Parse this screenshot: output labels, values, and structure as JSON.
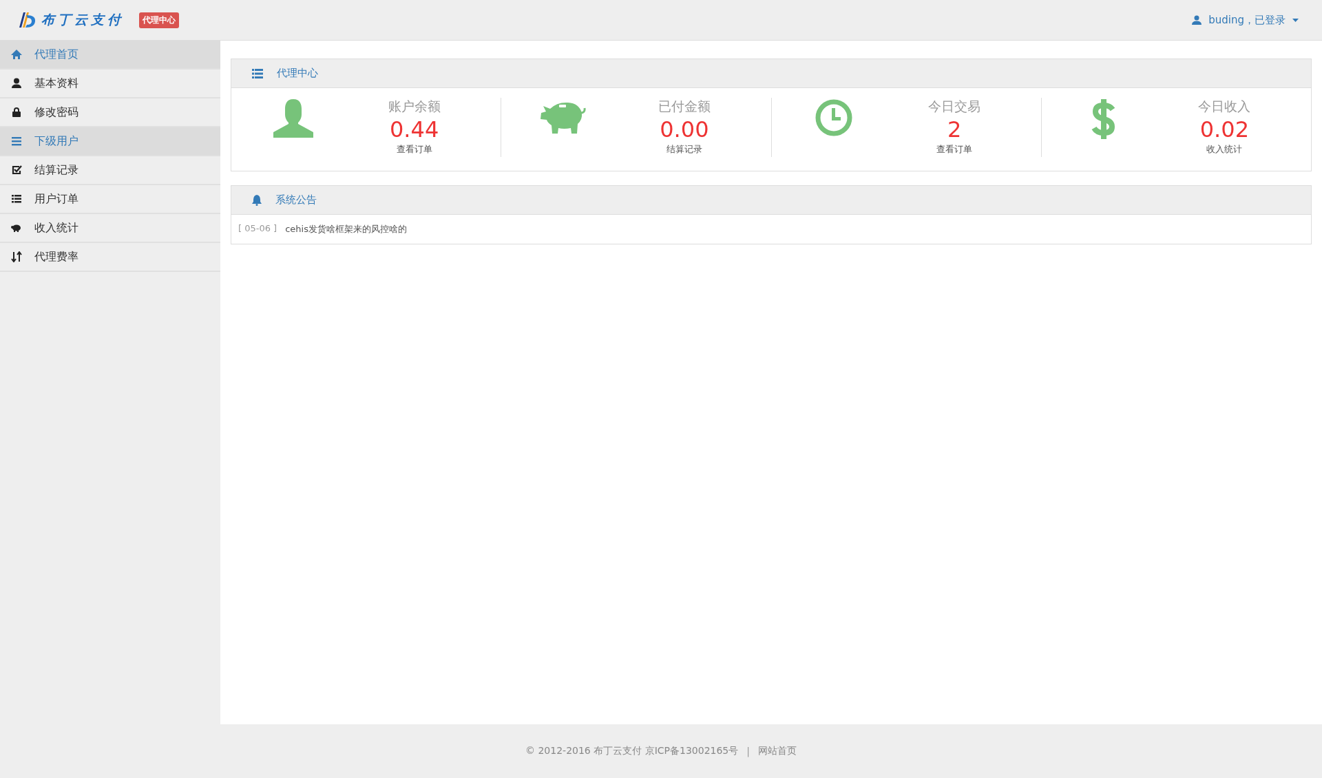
{
  "header": {
    "logo_text": "布丁云支付",
    "badge": "代理中心",
    "user": {
      "name": "buding，已登录"
    }
  },
  "sidebar": {
    "items": [
      {
        "label": "代理首页",
        "kind": "home",
        "selected": true
      },
      {
        "label": "基本资料",
        "kind": "user",
        "selected": false
      },
      {
        "label": "修改密码",
        "kind": "lock",
        "selected": false
      },
      {
        "label": "下级用户",
        "kind": "bars",
        "selected": true
      },
      {
        "label": "结算记录",
        "kind": "check",
        "selected": false
      },
      {
        "label": "用户订单",
        "kind": "list",
        "selected": false
      },
      {
        "label": "收入统计",
        "kind": "piggy",
        "selected": false
      },
      {
        "label": "代理费率",
        "kind": "sort",
        "selected": false
      }
    ]
  },
  "overview": {
    "title": "代理中心",
    "stats": [
      {
        "kind": "user",
        "label": "账户余额",
        "value": "0.44",
        "link": "查看订单"
      },
      {
        "kind": "piggy",
        "label": "已付金额",
        "value": "0.00",
        "link": "结算记录"
      },
      {
        "kind": "clock",
        "label": "今日交易",
        "value": "2",
        "link": "查看订单"
      },
      {
        "kind": "dollar",
        "label": "今日收入",
        "value": "0.02",
        "link": "收入统计"
      }
    ]
  },
  "notices": {
    "title": "系统公告",
    "items": [
      {
        "date": "[ 05-06 ]",
        "text": "cehis发货啥框架来的风控啥的"
      }
    ]
  },
  "footer": {
    "copyright": "© 2012-2016  布丁云支付  京ICP备13002165号",
    "separator": "|",
    "link": "网站首页"
  }
}
